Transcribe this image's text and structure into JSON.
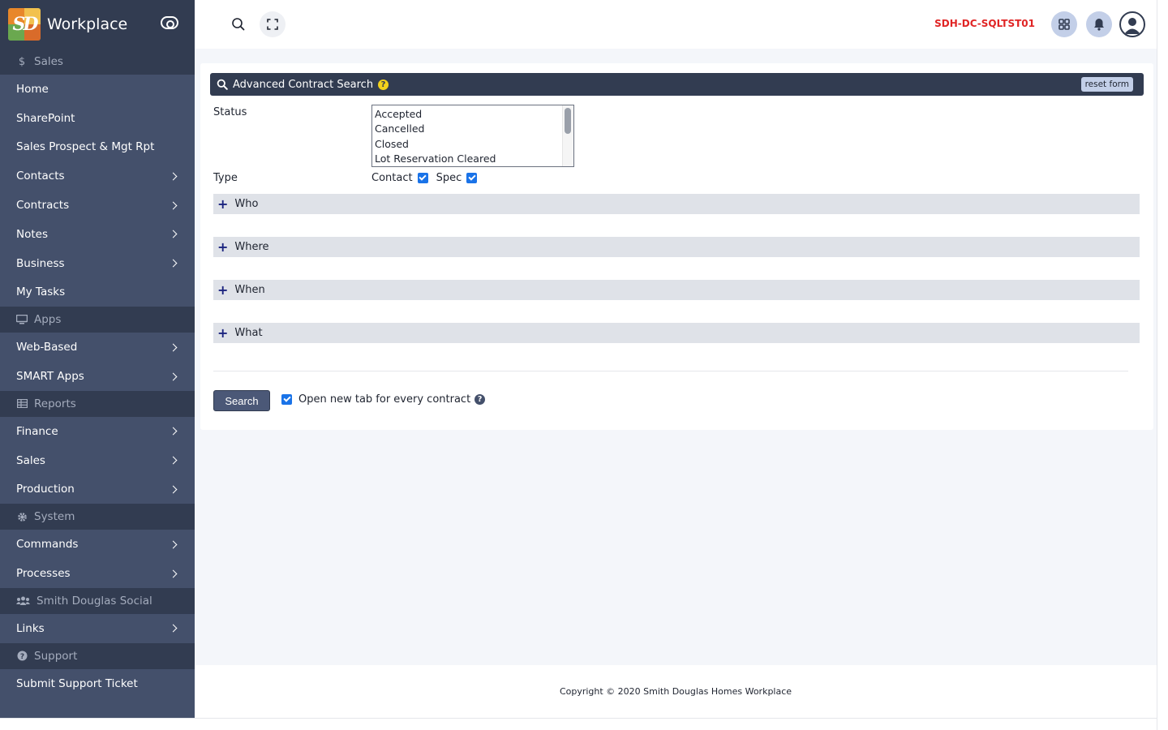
{
  "app": {
    "name": "Workplace",
    "logo_text": "SD"
  },
  "sidebar": {
    "sales_section": "Sales",
    "home": "Home",
    "sharepoint": "SharePoint",
    "sales_prospect": "Sales Prospect & Mgt Rpt",
    "contacts": "Contacts",
    "contracts": "Contracts",
    "notes": "Notes",
    "business": "Business",
    "my_tasks": "My Tasks",
    "apps_section": "Apps",
    "web_based": "Web-Based",
    "smart_apps": "SMART Apps",
    "reports_section": "Reports",
    "finance": "Finance",
    "sales": "Sales",
    "production": "Production",
    "system_section": "System",
    "commands": "Commands",
    "processes": "Processes",
    "social_section": "Smith Douglas Social",
    "links": "Links",
    "support_section": "Support",
    "submit_ticket": "Submit Support Ticket"
  },
  "topbar": {
    "server_name": "SDH-DC-SQLTST01"
  },
  "search_form": {
    "title": "Advanced Contract Search",
    "reset_label": "reset form",
    "status_label": "Status",
    "status_options": [
      "Accepted",
      "Cancelled",
      "Closed",
      "Lot Reservation Cleared"
    ],
    "type_label": "Type",
    "type_contact": "Contact",
    "type_spec": "Spec",
    "sections": [
      "Who",
      "Where",
      "When",
      "What"
    ],
    "search_label": "Search",
    "new_tab_label": "Open new tab for every contract"
  },
  "footer": {
    "copyright": "Copyright © 2020 Smith Douglas Homes Workplace"
  },
  "colors": {
    "sidebar": "#44506b",
    "sidebar_dark": "#323c51",
    "accent": "#1a73e8",
    "server": "#e02424"
  }
}
